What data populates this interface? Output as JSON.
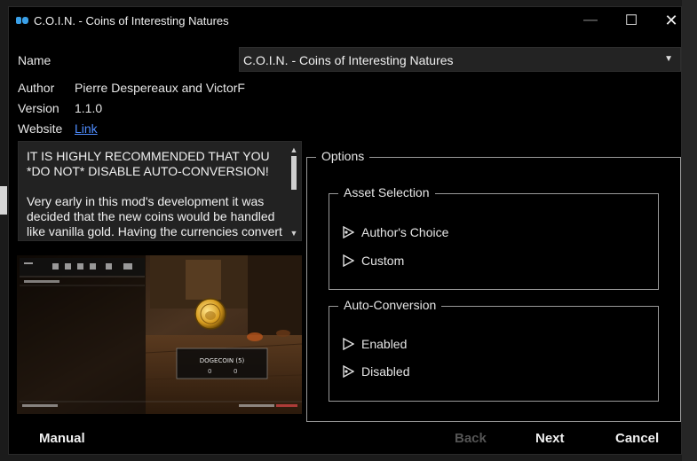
{
  "window": {
    "title": "C.O.I.N. - Coins of Interesting Natures",
    "minimize_glyph": "—",
    "maximize_glyph": "☐",
    "close_glyph": "✕"
  },
  "info": {
    "name_label": "Name",
    "name_value": "C.O.I.N. - Coins of Interesting Natures",
    "author_label": "Author",
    "author_value": "Pierre Despereaux and VictorF",
    "version_label": "Version",
    "version_value": "1.1.0",
    "website_label": "Website",
    "website_link": "Link"
  },
  "description": "IT IS HIGHLY RECOMMENDED THAT YOU *DO NOT* DISABLE AUTO-CONVERSION!\n\nVery early in this mod's development it was decided that the new coins would be handled like vanilla gold. Having the currencies convert",
  "options": {
    "legend": "Options",
    "groups": [
      {
        "legend": "Asset Selection",
        "items": [
          "Author's Choice",
          "Custom"
        ]
      },
      {
        "legend": "Auto-Conversion",
        "items": [
          "Enabled",
          "Disabled"
        ]
      }
    ]
  },
  "buttons": {
    "manual": "Manual",
    "back": "Back",
    "next": "Next",
    "cancel": "Cancel"
  },
  "preview": {
    "caption": "DOGECOIN (5)",
    "qty_label": "0"
  },
  "colors": {
    "background": "#000000",
    "panel": "#222222",
    "link": "#4f8dff",
    "border": "#9a9a9a",
    "disabled": "#555555"
  }
}
